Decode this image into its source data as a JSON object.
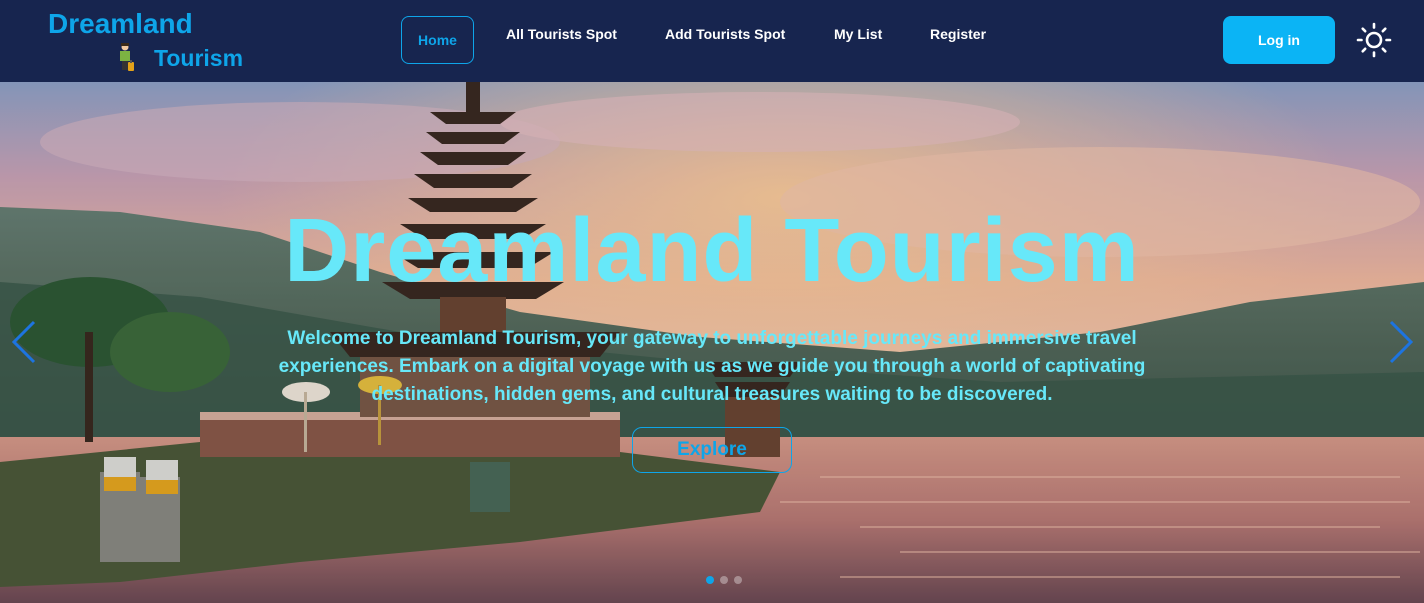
{
  "brand": {
    "name_line1": "Dreamland",
    "name_line2": "Tourism"
  },
  "nav": {
    "home": "Home",
    "all_spots": "All Tourists Spot",
    "add_spot": "Add Tourists Spot",
    "my_list": "My List",
    "register": "Register",
    "login": "Log in",
    "theme_icon": "sun-icon"
  },
  "hero": {
    "title": "Dreamland Tourism",
    "description": "Welcome to Dreamland Tourism, your gateway to unforgettable journeys and immersive travel experiences. Embark on a digital voyage with us as we guide you through a world of captivating destinations, hidden gems, and cultural treasures waiting to be discovered.",
    "cta": "Explore",
    "slide_count": 3,
    "active_slide": 1
  },
  "colors": {
    "navbar_bg": "#17254f",
    "accent": "#0ea5e9",
    "login_bg": "#0bb4f5",
    "hero_text": "#67e8f9"
  }
}
